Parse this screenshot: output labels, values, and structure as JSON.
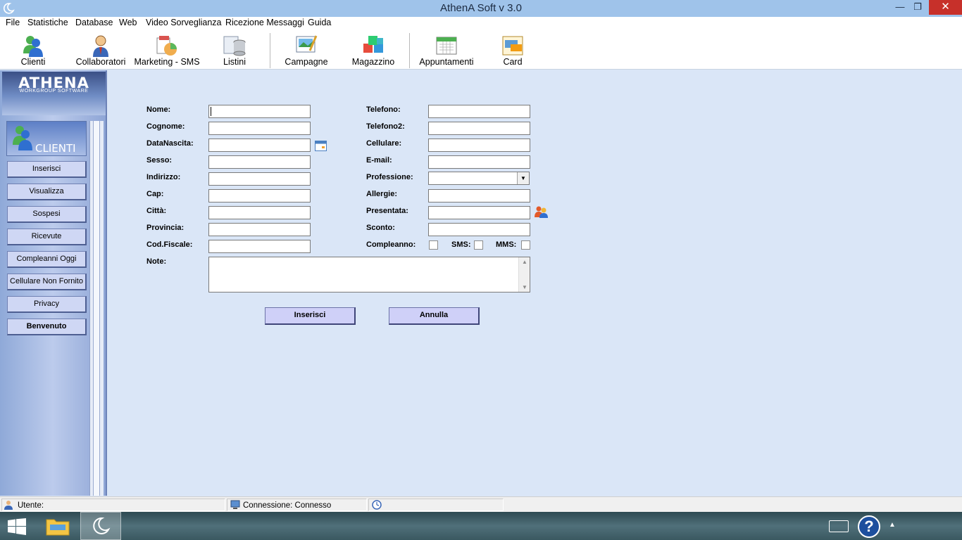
{
  "window": {
    "title": "AthenA Soft v 3.0",
    "minimize": "—",
    "maximize": "❐",
    "close": "✕"
  },
  "menu": [
    "File",
    "Statistiche",
    "Database",
    "Web",
    "Video Sorveglianza",
    "Ricezione Messaggi",
    "Guida"
  ],
  "toolbar": [
    {
      "label": "Clienti",
      "icon": "users-icon"
    },
    {
      "label": "Collaboratori",
      "icon": "collaborator-icon"
    },
    {
      "label": "Marketing - SMS",
      "icon": "marketing-icon"
    },
    {
      "label": "Listini",
      "icon": "database-icon"
    },
    {
      "label": "Campagne",
      "icon": "campaign-icon"
    },
    {
      "label": "Magazzino",
      "icon": "warehouse-icon"
    },
    {
      "label": "Appuntamenti",
      "icon": "calendar-icon"
    },
    {
      "label": "Card",
      "icon": "card-icon"
    }
  ],
  "sidebar": {
    "logo_title": "ATHENA",
    "logo_subtitle": "WORKGROUP SOFTWARE",
    "section_title": "CLIENTI",
    "buttons": [
      "Inserisci",
      "Visualizza",
      "Sospesi",
      "Ricevute",
      "Compleanni Oggi",
      "Cellulare Non Fornito",
      "Privacy",
      "Benvenuto"
    ]
  },
  "form": {
    "left_labels": [
      "Nome:",
      "Cognome:",
      "DataNascita:",
      "Sesso:",
      "Indirizzo:",
      "Cap:",
      "Città:",
      "Provincia:",
      "Cod.Fiscale:"
    ],
    "right_labels": [
      "Telefono:",
      "Telefono2:",
      "Cellulare:",
      "E-mail:",
      "Professione:",
      "Allergie:",
      "Presentata:",
      "Sconto:"
    ],
    "compleanno_label": "Compleanno:",
    "sms_label": "SMS:",
    "mms_label": "MMS:",
    "note_label": "Note:",
    "submit": "Inserisci",
    "cancel": "Annulla"
  },
  "status": {
    "user": "Utente:",
    "connection": "Connessione: Connesso"
  },
  "colors": {
    "titlebar": "#9fc3ea",
    "content_bg": "#dae6f7",
    "button": "#cfd0f8",
    "close": "#c7302a"
  }
}
